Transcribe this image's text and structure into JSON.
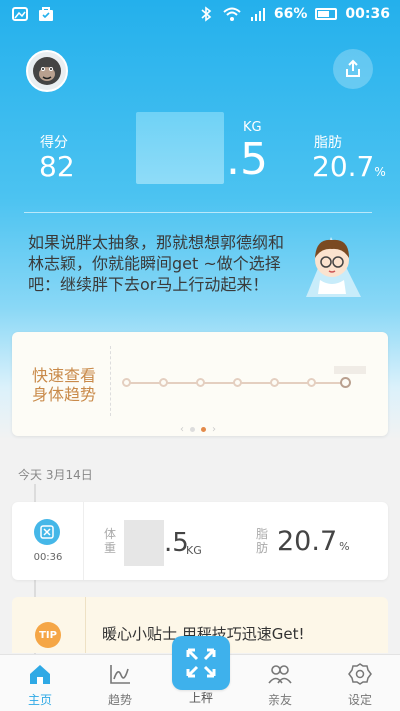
{
  "status_bar": {
    "battery_percent": "66%",
    "time": "00:36"
  },
  "summary": {
    "score_label": "得分",
    "score_value": "82",
    "weight_decimal": ".5",
    "weight_unit": "KG",
    "fat_label": "脂肪",
    "fat_value": "20.7",
    "fat_unit": "%"
  },
  "tip_message": "如果说胖太抽象，那就想想郭德纲和林志颖，你就能瞬间get ~做个选择吧：继续胖下去or马上行动起来！",
  "trend_card": {
    "title": "快速查看身体趋势",
    "page_index": 1,
    "page_count": 2
  },
  "timeline": {
    "date": "今天 3月14日",
    "record": {
      "time": "00:36",
      "weight_label": "体重",
      "weight_decimal": ".5",
      "weight_unit": "KG",
      "fat_label": "脂肪",
      "fat_value": "20.7",
      "fat_unit": "%"
    },
    "tip": {
      "badge": "TIP",
      "title": "暖心小贴士 用秤技巧迅速Get!"
    }
  },
  "tabbar": {
    "home": "主页",
    "trend": "趋势",
    "weigh": "上秤",
    "friends": "亲友",
    "settings": "设定"
  },
  "colors": {
    "accent": "#2fa9e5",
    "header_top": "#24b0ec",
    "trend_title": "#c98a4a",
    "tip_badge": "#f5a646"
  }
}
